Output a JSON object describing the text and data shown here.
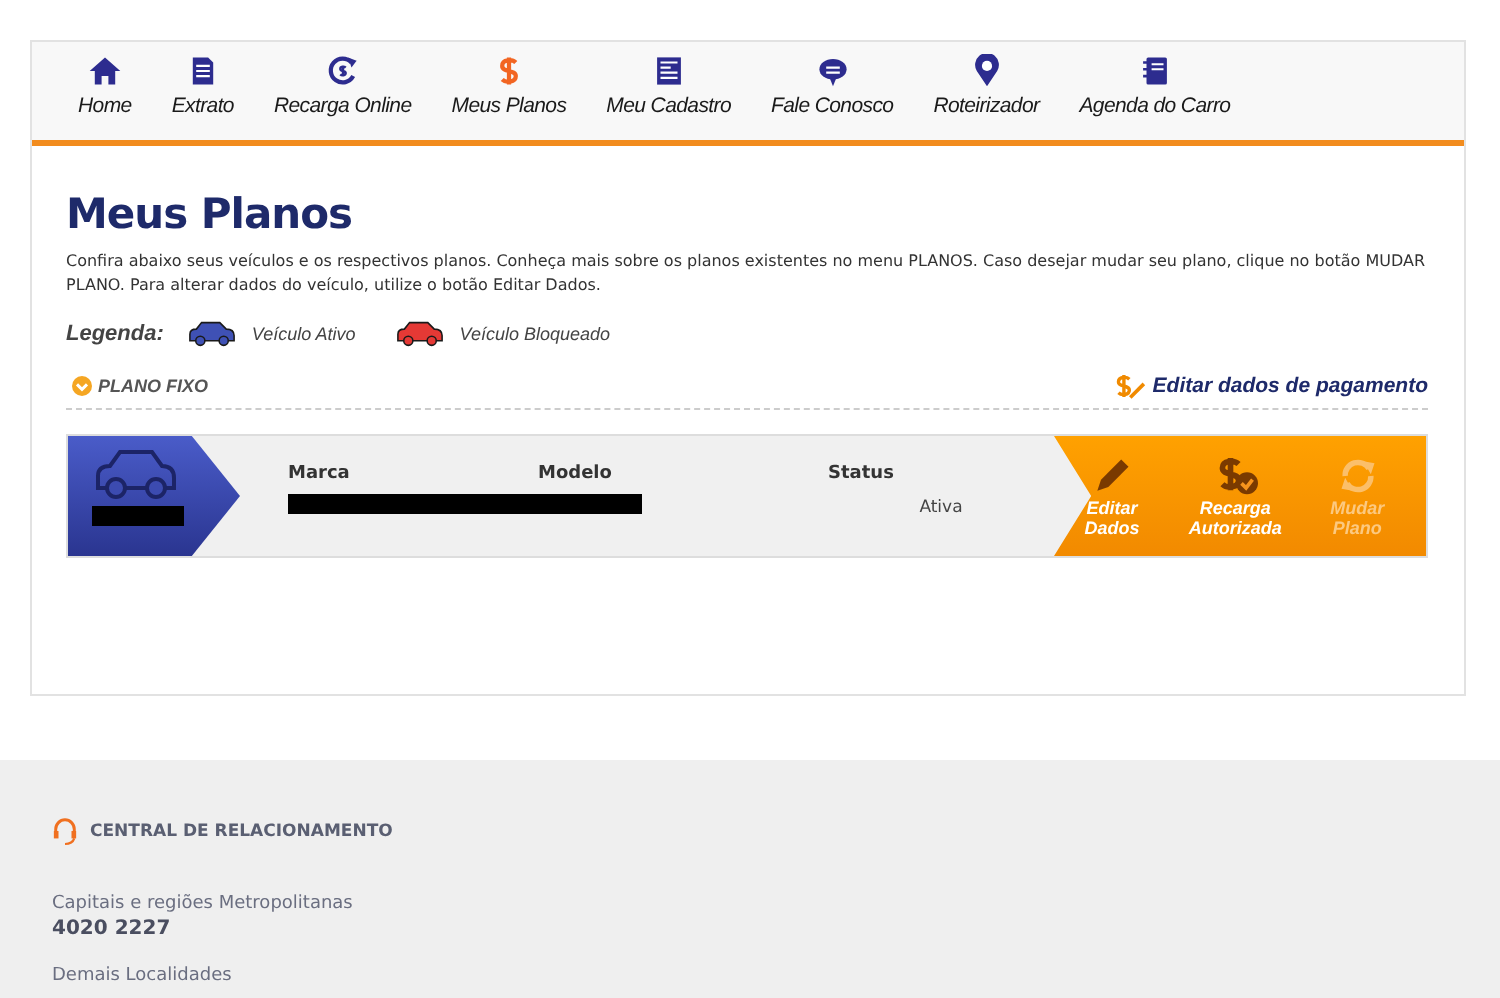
{
  "nav": [
    {
      "label": "Home",
      "selected": false
    },
    {
      "label": "Extrato",
      "selected": false
    },
    {
      "label": "Recarga Online",
      "selected": false
    },
    {
      "label": "Meus Planos",
      "selected": true
    },
    {
      "label": "Meu Cadastro",
      "selected": false
    },
    {
      "label": "Fale Conosco",
      "selected": false
    },
    {
      "label": "Roteirizador",
      "selected": false
    },
    {
      "label": "Agenda do Carro",
      "selected": false
    }
  ],
  "title": "Meus Planos",
  "intro": "Confira abaixo seus veículos e os respectivos planos. Conheça mais sobre os planos existentes no menu PLANOS. Caso desejar mudar seu plano, clique no botão MUDAR PLANO. Para alterar dados do veículo, utilize o botão Editar Dados.",
  "legend": {
    "label": "Legenda:",
    "items": [
      {
        "label": "Veículo Ativo",
        "color": "#3f51b5"
      },
      {
        "label": "Veículo Bloqueado",
        "color": "#e53935"
      }
    ]
  },
  "plan": {
    "name": "PLANO FIXO",
    "payment_link": "Editar dados de pagamento"
  },
  "vehicle": {
    "columns": [
      {
        "header": "Marca"
      },
      {
        "header": "Modelo"
      },
      {
        "header": "Status",
        "value": "Ativa"
      }
    ],
    "actions": [
      {
        "label": "Editar Dados",
        "disabled": false
      },
      {
        "label": "Recarga Autorizada",
        "disabled": false
      },
      {
        "label": "Mudar Plano",
        "disabled": true
      }
    ]
  },
  "footer": {
    "heading": "CENTRAL DE RELACIONAMENTO",
    "contacts": [
      {
        "label": "Capitais e regiões Metropolitanas",
        "number": "4020 2227"
      },
      {
        "label": "Demais Localidades"
      }
    ]
  }
}
